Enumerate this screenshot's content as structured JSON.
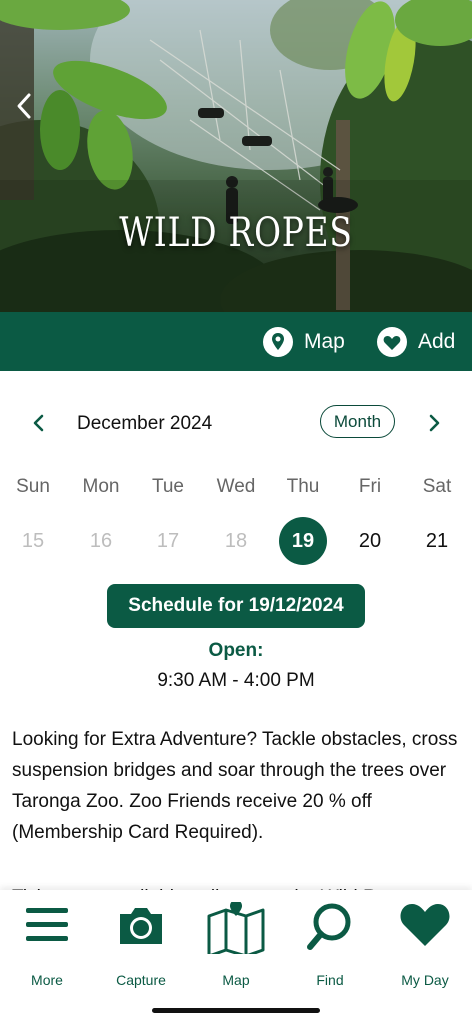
{
  "hero": {
    "title": "WILD ROPES",
    "back_icon": "chevron-left-icon"
  },
  "actions": {
    "map_label": "Map",
    "add_label": "Add",
    "map_icon": "location-pin-icon",
    "add_icon": "heart-icon"
  },
  "calendar": {
    "month_label": "December 2024",
    "view_toggle": "Month",
    "weekdays": [
      "Sun",
      "Mon",
      "Tue",
      "Wed",
      "Thu",
      "Fri",
      "Sat"
    ],
    "days": [
      "15",
      "16",
      "17",
      "18",
      "19",
      "20",
      "21"
    ],
    "selected_day": "19"
  },
  "schedule": {
    "button_label": "Schedule for 19/12/2024",
    "open_label": "Open:",
    "hours": "9:30 AM - 4:00 PM"
  },
  "description": {
    "paragraph": "Looking for Extra Adventure? Tackle obstacles, cross suspension bridges and soar through the trees over Taronga Zoo. Zoo Friends receive 20 % off (Membership Card Required).",
    "partial_line": "Tickets are available online or at the Wild Ro..."
  },
  "bottom_nav": {
    "items": [
      {
        "label": "More",
        "icon": "menu-icon"
      },
      {
        "label": "Capture",
        "icon": "camera-icon"
      },
      {
        "label": "Map",
        "icon": "map-icon"
      },
      {
        "label": "Find",
        "icon": "search-icon"
      },
      {
        "label": "My Day",
        "icon": "heart-icon"
      }
    ]
  },
  "colors": {
    "brand_green": "#0b5a44",
    "past_day": "#bdbdbd",
    "text": "#111111"
  }
}
